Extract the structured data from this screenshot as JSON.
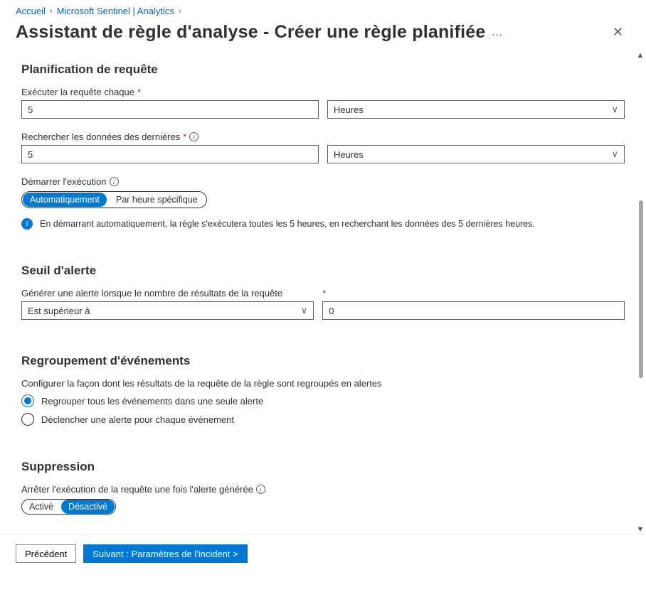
{
  "breadcrumbs": {
    "home": "Accueil",
    "sentinel": "Microsoft Sentinel | Analytics"
  },
  "title": "Assistant de règle d'analyse - Créer une règle planifiée",
  "schedule": {
    "heading": "Planification de requête",
    "run_every_label": "Exécuter la requête chaque",
    "run_every_value": "5",
    "run_every_unit": "Heures",
    "lookup_label": "Rechercher les données des dernières",
    "lookup_value": "5",
    "lookup_unit": "Heures",
    "start_label": "Démarrer l'exécution",
    "start_auto": "Automatiquement",
    "start_specific": "Par heure spécifique",
    "info_text": "En démarrant automatiquement, la règle s'exécutera toutes les 5 heures, en recherchant les données des 5 dernières heures."
  },
  "threshold": {
    "heading": "Seuil d'alerte",
    "label": "Générer une alerte lorsque le nombre de résultats de la requête",
    "operator": "Est supérieur à",
    "value": "0"
  },
  "grouping": {
    "heading": "Regroupement d'événements",
    "label": "Configurer la façon dont les résultats de la requête de la règle sont regroupés en alertes",
    "opt_all": "Regrouper tous les événements dans une seule alerte",
    "opt_each": "Déclencher une alerte pour chaque événement"
  },
  "suppression": {
    "heading": "Suppression",
    "label": "Arrêter l'exécution de la requête une fois l'alerte générée",
    "on": "Activé",
    "off": "Désactivé"
  },
  "footer": {
    "back": "Précédent",
    "next": "Suivant : Paramètres de l'incident >"
  }
}
